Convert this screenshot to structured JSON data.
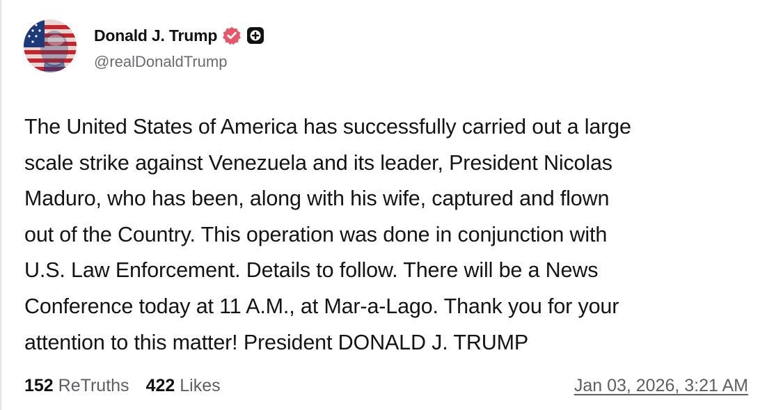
{
  "author": {
    "display_name": "Donald J. Trump",
    "handle": "@realDonaldTrump",
    "verified_color": "#e5576c"
  },
  "post": {
    "text": "The United States of America has successfully carried out a large\nscale strike against Venezuela and its leader, President Nicolas\nMaduro, who has been, along with his wife, captured and flown\nout of the Country. This operation was done in conjunction with\nU.S. Law Enforcement. Details to follow. There will be a News\nConference today at 11 A.M., at Mar-a-Lago. Thank you for your\nattention to this matter! President DONALD J. TRUMP"
  },
  "stats": {
    "retruths_count": "152",
    "retruths_label": "ReTruths",
    "likes_count": "422",
    "likes_label": "Likes"
  },
  "timestamp": "Jan 03, 2026, 3:21 AM",
  "icons": {
    "verified": "verified-badge-icon",
    "plus": "plus-badge-icon",
    "avatar": "avatar"
  }
}
